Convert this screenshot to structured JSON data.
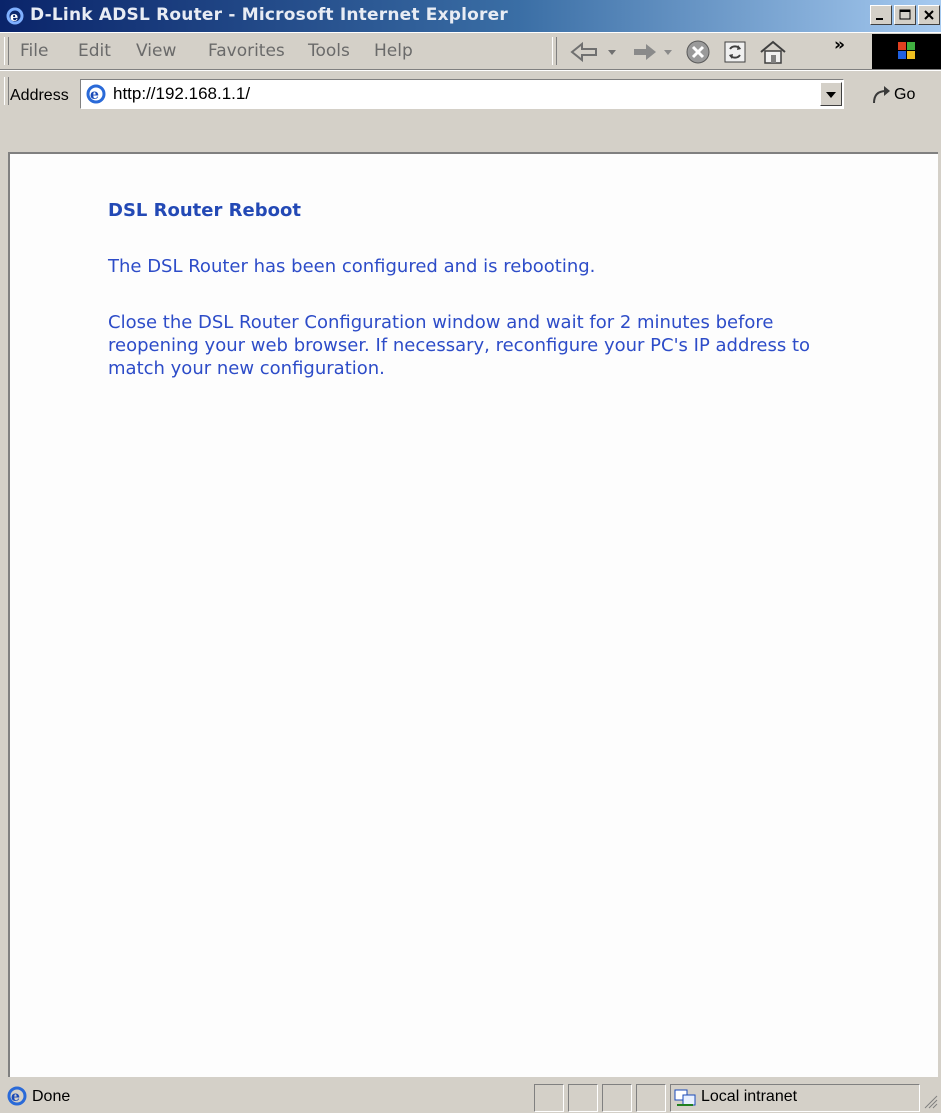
{
  "window": {
    "title": "D-Link ADSL Router - Microsoft Internet Explorer"
  },
  "menu": {
    "items": [
      "File",
      "Edit",
      "View",
      "Favorites",
      "Tools",
      "Help"
    ],
    "chevron": "»"
  },
  "toolbar": {
    "icons": [
      "back-arrow-icon",
      "forward-arrow-icon",
      "stop-icon",
      "refresh-icon",
      "home-icon"
    ]
  },
  "address": {
    "label": "Address",
    "url": "http://192.168.1.1/",
    "go_label": "Go"
  },
  "page": {
    "heading": "DSL Router Reboot",
    "paragraph1": "The DSL Router has been configured and is rebooting.",
    "paragraph2": "Close the DSL Router Configuration window and wait for 2 minutes before reopening your web browser. If necessary, reconfigure your PC's IP address to match your new configuration."
  },
  "status": {
    "text": "Done",
    "zone": "Local intranet"
  },
  "colors": {
    "heading": "#2349b5",
    "body_text": "#2d4cc8",
    "titlebar_start": "#0a246a",
    "titlebar_end": "#a6caf0"
  }
}
